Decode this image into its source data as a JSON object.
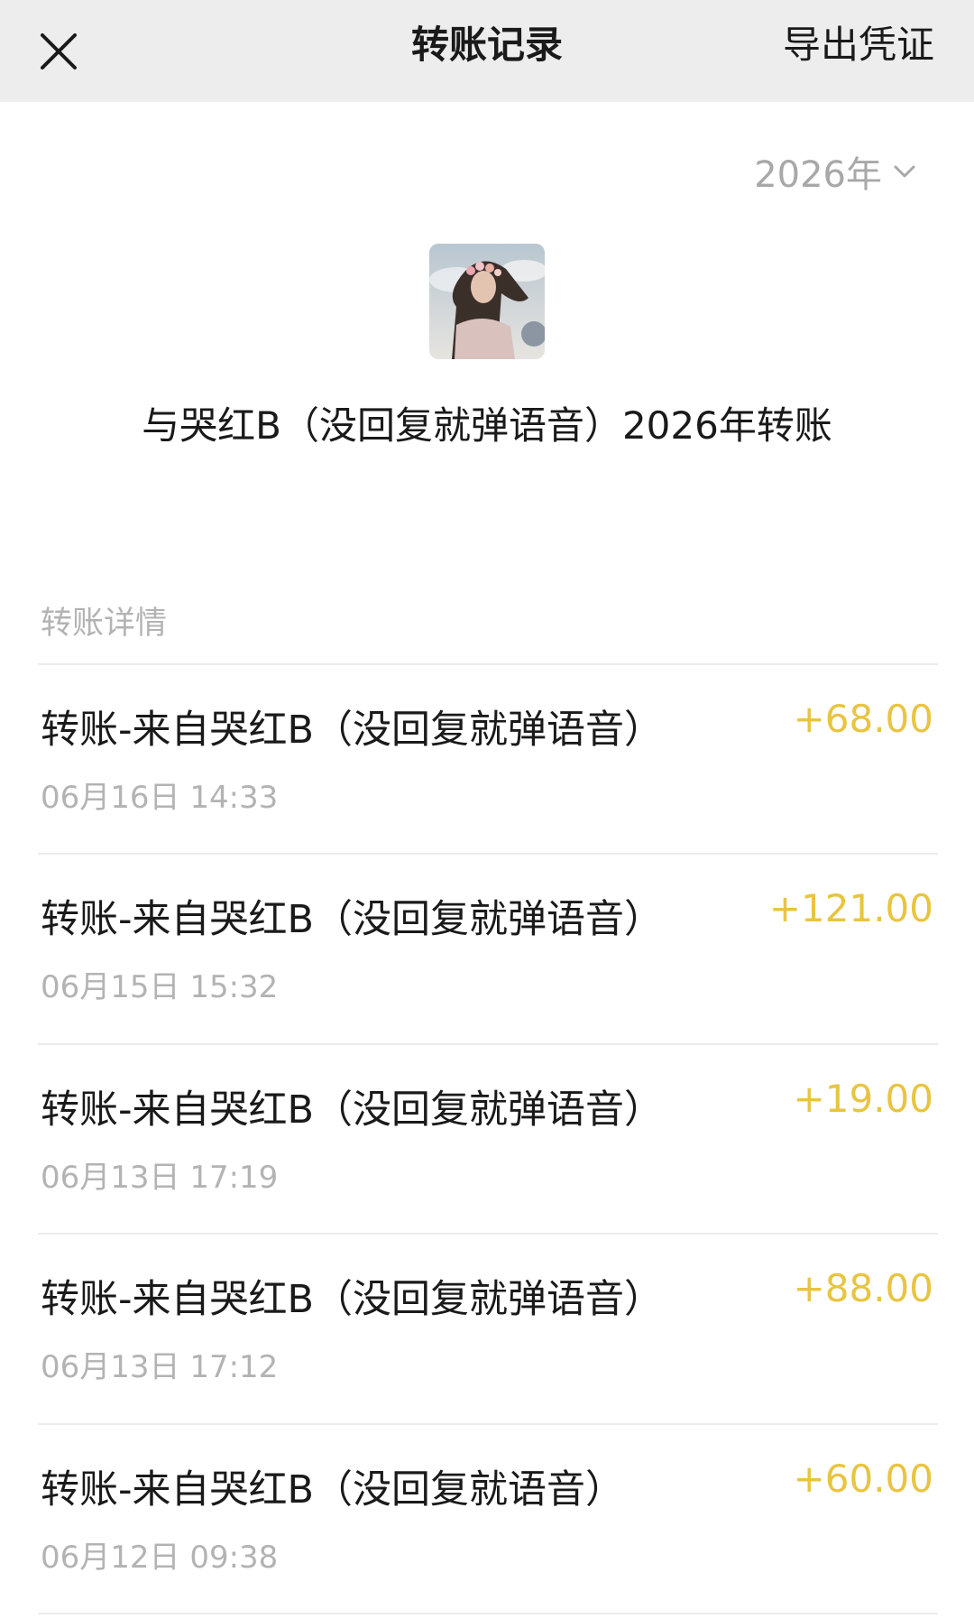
{
  "header": {
    "title": "转账记录",
    "export_label": "导出凭证",
    "close_icon": "close-icon"
  },
  "year_picker": {
    "value": "2026年",
    "icon": "chevron-down-icon"
  },
  "summary": {
    "title": "与哭红B（没回复就弹语音）2026年转账"
  },
  "section_label": "转账详情",
  "records": [
    {
      "title": "转账-来自哭红B（没回复就弹语音）",
      "time": "06月16日 14:33",
      "amount": "+68.00"
    },
    {
      "title": "转账-来自哭红B（没回复就弹语音）",
      "time": "06月15日 15:32",
      "amount": "+121.00"
    },
    {
      "title": "转账-来自哭红B（没回复就弹语音）",
      "time": "06月13日 17:19",
      "amount": "+19.00"
    },
    {
      "title": "转账-来自哭红B（没回复就弹语音）",
      "time": "06月13日 17:12",
      "amount": "+88.00"
    },
    {
      "title": "转账-来自哭红B（没回复就语音）",
      "time": "06月12日 09:38",
      "amount": "+60.00"
    }
  ],
  "colors": {
    "amount": "#e8c441",
    "secondary_text": "#b3b3b3",
    "header_bg": "#ededed"
  }
}
